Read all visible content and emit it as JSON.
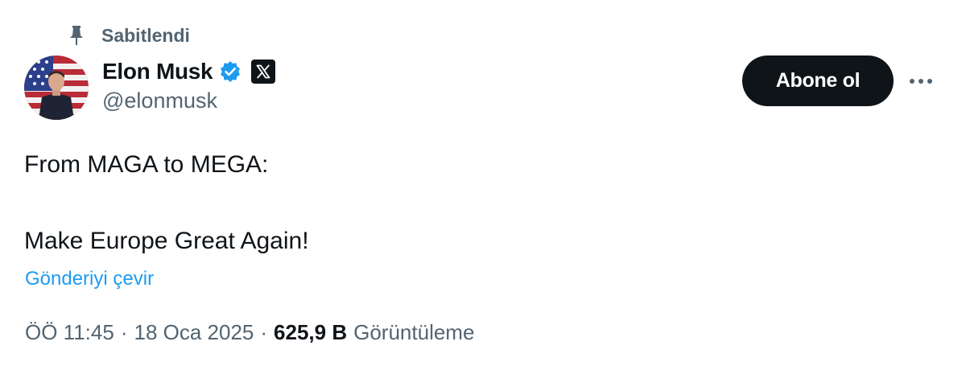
{
  "pinned": {
    "label": "Sabitlendi",
    "icon": "pin-icon"
  },
  "author": {
    "display_name": "Elon Musk",
    "handle": "@elonmusk",
    "verified_icon": "verified-badge-icon",
    "affiliation_icon": "x-logo-icon"
  },
  "actions": {
    "follow_label": "Abone ol",
    "more_icon": "more-options-icon"
  },
  "tweet": {
    "line1": "From MAGA to MEGA:",
    "line2": "Make Europe Great Again!"
  },
  "translate_label": "Gönderiyi çevir",
  "meta": {
    "time": "ÖÖ 11:45",
    "separator": "·",
    "date": "18 Oca 2025",
    "views_count": "625,9 B",
    "views_label": "Görüntüleme"
  },
  "colors": {
    "text_primary": "#0f1419",
    "text_secondary": "#536471",
    "link": "#1d9bf0",
    "verified": "#1d9bf0",
    "button_bg": "#0f1419"
  }
}
